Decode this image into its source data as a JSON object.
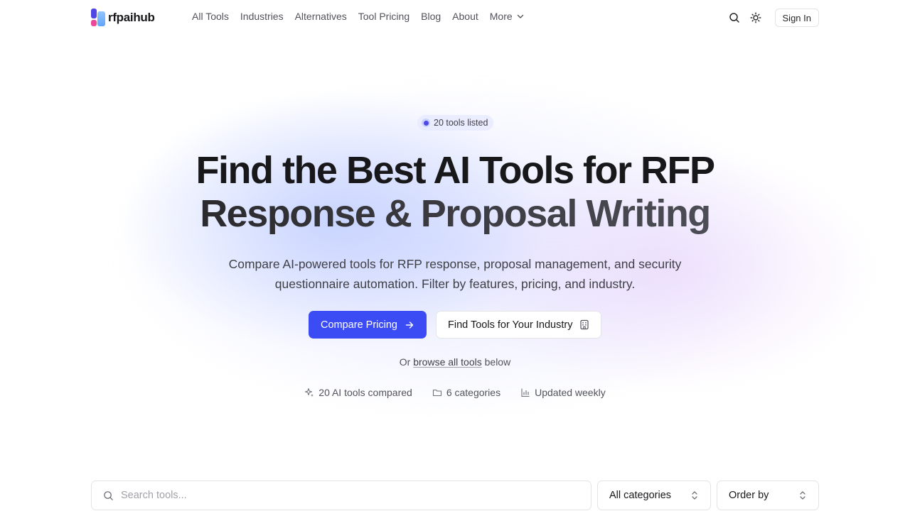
{
  "brand": {
    "name": "rfpaihub"
  },
  "nav": {
    "items": [
      "All Tools",
      "Industries",
      "Alternatives",
      "Tool Pricing",
      "Blog",
      "About"
    ],
    "more_label": "More"
  },
  "header": {
    "signin_label": "Sign In"
  },
  "hero": {
    "badge": "20 tools listed",
    "title_line1": "Find the Best AI Tools for RFP",
    "title_line2": "Response & Proposal Writing",
    "subtitle_line1": "Compare AI-powered tools for RFP response, proposal management, and security",
    "subtitle_line2": "questionnaire automation. Filter by features, pricing, and industry.",
    "primary_cta": "Compare Pricing",
    "secondary_cta": "Find Tools for Your Industry",
    "browse_prefix": "Or",
    "browse_link": "browse all tools",
    "browse_suffix": "below",
    "stats": [
      "20 AI tools compared",
      "6 categories",
      "Updated weekly"
    ]
  },
  "filters": {
    "search_placeholder": "Search tools...",
    "category_value": "All categories",
    "order_value": "Order by"
  },
  "colors": {
    "accent": "#3b4cf5",
    "brand_pink": "#ec4899",
    "brand_indigo": "#4f46e5"
  }
}
